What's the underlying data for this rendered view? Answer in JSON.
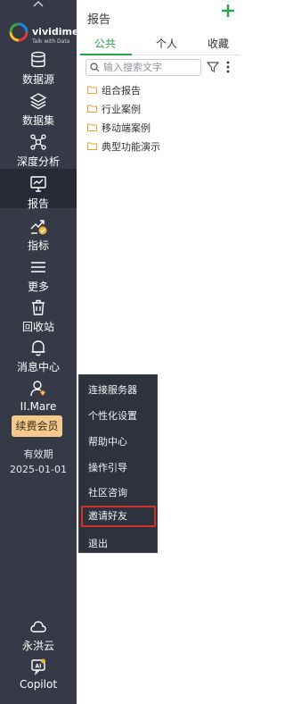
{
  "brand": {
    "name": "vividime",
    "tagline": "Talk with Data"
  },
  "sidebar": {
    "items": [
      {
        "label": "数据源",
        "icon": "database-icon"
      },
      {
        "label": "数据集",
        "icon": "layers-icon"
      },
      {
        "label": "深度分析",
        "icon": "network-icon"
      },
      {
        "label": "报告",
        "icon": "report-icon"
      },
      {
        "label": "指标",
        "icon": "metric-icon"
      },
      {
        "label": "更多",
        "icon": "menu-icon"
      },
      {
        "label": "回收站",
        "icon": "trash-icon"
      },
      {
        "label": "消息中心",
        "icon": "bell-icon"
      }
    ],
    "user": {
      "name": "II.Mare",
      "icon": "user-icon"
    },
    "vip_button": "续费会员",
    "valid_label": "有效期",
    "valid_date": "2025-01-01",
    "bottom": [
      {
        "label": "永洪云",
        "icon": "cloud-icon"
      },
      {
        "label": "Copilot",
        "icon": "ai-icon"
      }
    ]
  },
  "panel": {
    "title": "报告",
    "tabs": [
      "公共",
      "个人",
      "收藏"
    ],
    "search": {
      "placeholder": "输入搜索文字"
    },
    "folders": [
      "组合报告",
      "行业案例",
      "移动端案例",
      "典型功能演示"
    ]
  },
  "menu": {
    "items": [
      "连接服务器",
      "个性化设置",
      "帮助中心",
      "操作引导",
      "社区咨询",
      "邀请好友",
      "退出"
    ]
  },
  "colors": {
    "accent": "#27a44a",
    "sidebar": "#353a46",
    "vip": "#f5c98d",
    "highlight": "#d7302b"
  }
}
